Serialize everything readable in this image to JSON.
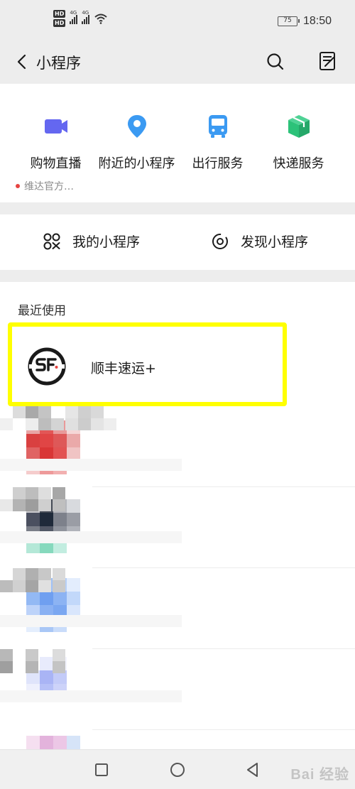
{
  "status_bar": {
    "network_badges": [
      "HD",
      "HD"
    ],
    "signal_labels": [
      "4G",
      "4G"
    ],
    "battery": "75",
    "time": "18:50"
  },
  "nav": {
    "title": "小程序",
    "icons": [
      "back-arrow-icon",
      "search-icon",
      "edit-list-icon"
    ]
  },
  "shortcuts": [
    {
      "label": "购物直播",
      "sub": "维达官方…",
      "icon": "video-camera-icon",
      "color": "#6467f0"
    },
    {
      "label": "附近的小程序",
      "icon": "location-pin-icon",
      "color": "#3b9af2"
    },
    {
      "label": "出行服务",
      "icon": "bus-icon",
      "color": "#3b9af2"
    },
    {
      "label": "快递服务",
      "icon": "package-box-icon",
      "color": "#2cc279"
    }
  ],
  "tabs": {
    "my_mini_programs": "我的小程序",
    "discover_mini_programs": "发现小程序"
  },
  "recent": {
    "section_title": "最近使用",
    "highlighted_item": {
      "name": "顺丰速运+",
      "icon": "sf-express-logo"
    },
    "highlight_color": "#ffff00"
  },
  "bottom_nav": {
    "icons": [
      "square-recents-icon",
      "circle-home-icon",
      "triangle-back-icon"
    ],
    "watermark": "Bai 经验"
  },
  "colors": {
    "background": "#ededed",
    "accent_blue": "#3b9af2",
    "notification_dot": "#e64340"
  }
}
